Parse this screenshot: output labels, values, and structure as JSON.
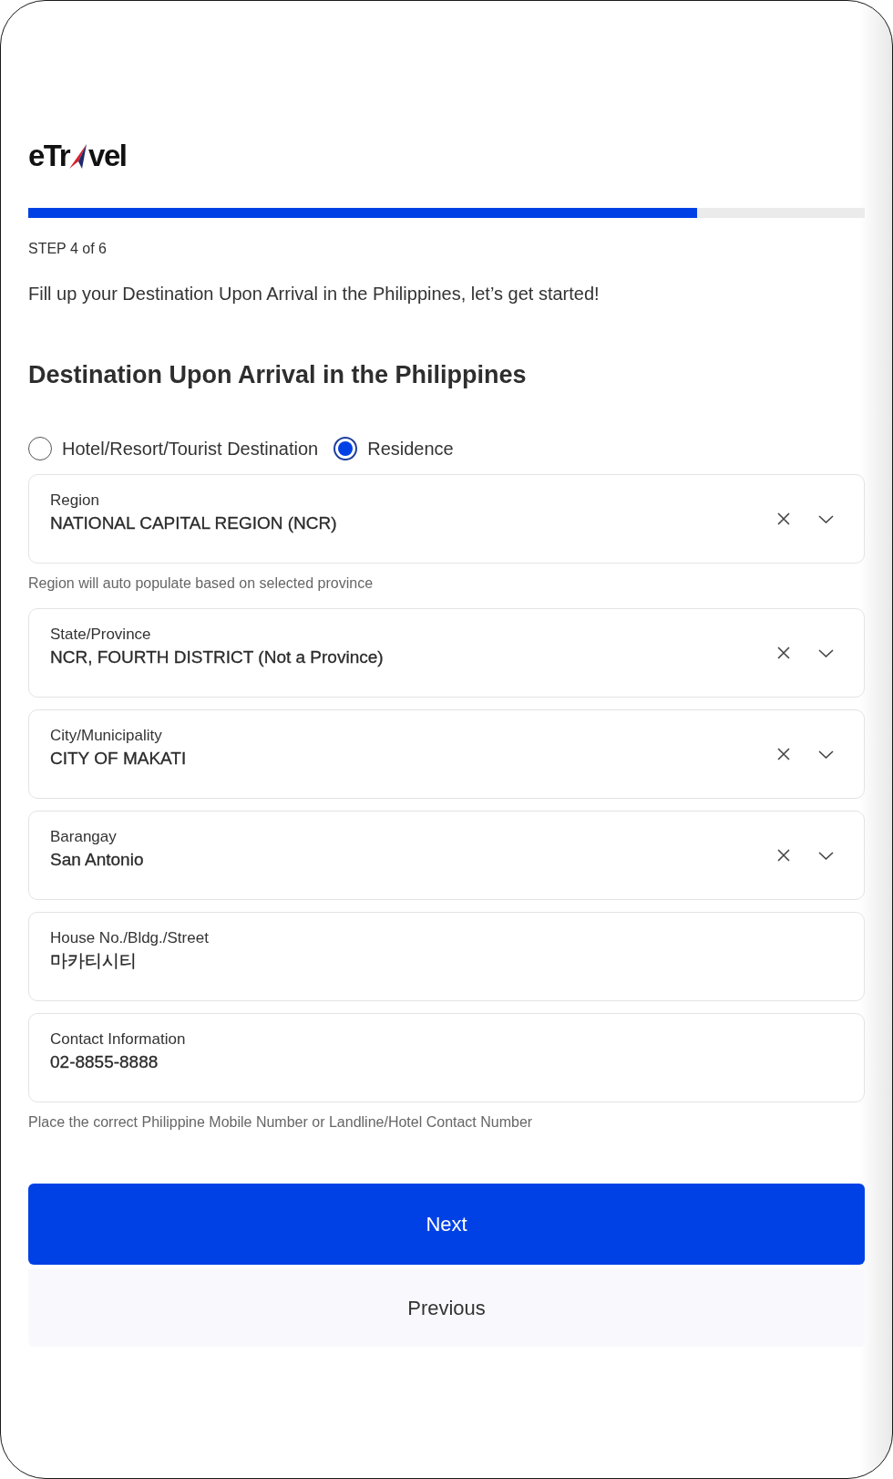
{
  "logo": {
    "lead": "eTr",
    "tail": "vel"
  },
  "progress": {
    "level": 0.8
  },
  "step": "STEP 4 of 6",
  "intro": "Fill up your Destination Upon Arrival in the Philippines, let’s get started!",
  "section_title": "Destination Upon Arrival in the Philippines",
  "destination_types": [
    {
      "label": "Hotel/Resort/Tourist Destination",
      "selected": false
    },
    {
      "label": "Residence",
      "selected": true
    }
  ],
  "fields": [
    {
      "kind": "select",
      "label": "Region",
      "value": "NATIONAL CAPITAL REGION (NCR)",
      "helper": "Region will auto populate based on selected province"
    },
    {
      "kind": "select",
      "label": "State/Province",
      "value": "NCR, FOURTH DISTRICT (Not a Province)"
    },
    {
      "kind": "select",
      "label": "City/Municipality",
      "value": "CITY OF MAKATI"
    },
    {
      "kind": "select",
      "label": "Barangay",
      "value": "San Antonio"
    },
    {
      "kind": "text",
      "label": "House No./Bldg./Street",
      "value": "마카티시티"
    },
    {
      "kind": "text",
      "label": "Contact Information",
      "value": "02-8855-8888",
      "helper": "Place the correct Philippine Mobile Number or Landline/Hotel Contact Number"
    }
  ],
  "buttons": [
    {
      "kind": "primary",
      "label": "Next"
    },
    {
      "kind": "secondary",
      "label": "Previous"
    }
  ]
}
